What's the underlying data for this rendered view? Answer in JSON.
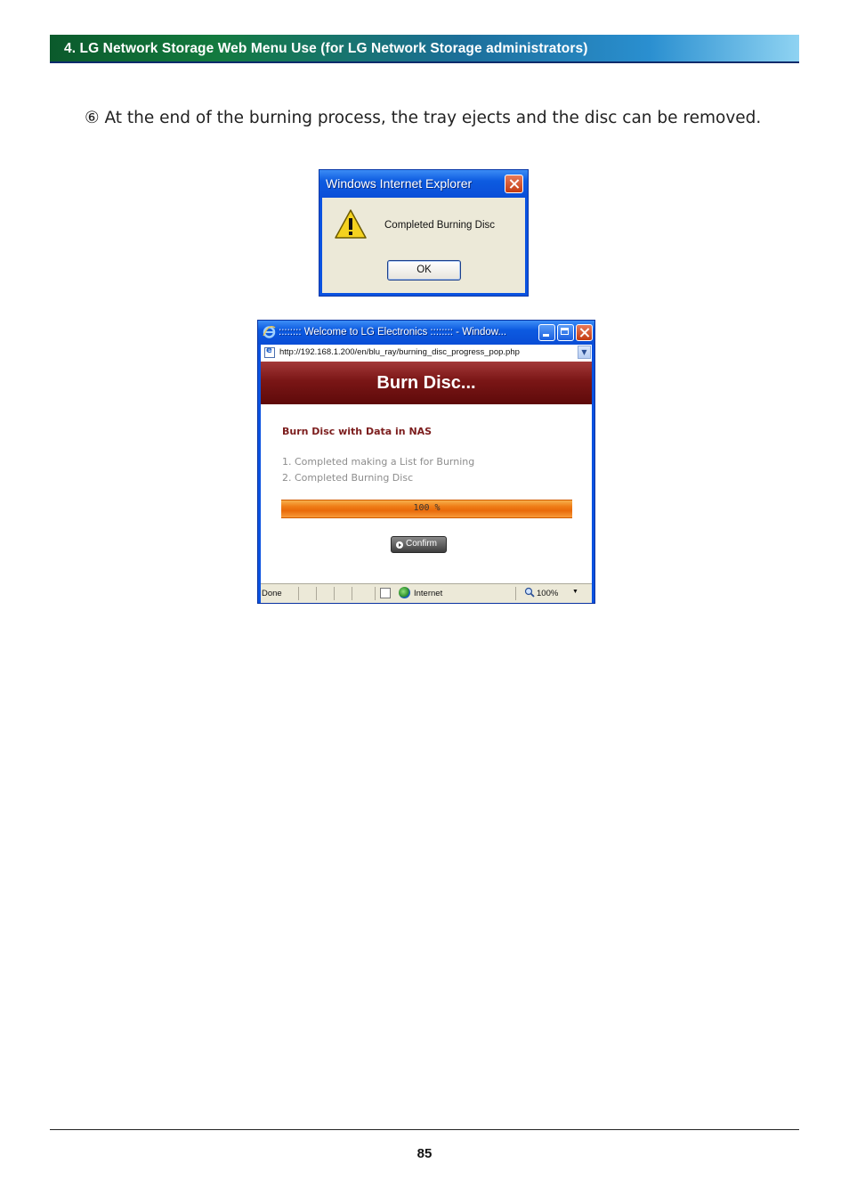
{
  "header": {
    "title": "4. LG Network Storage Web Menu Use (for LG Network Storage administrators)"
  },
  "step": {
    "text": "⑥ At the end of the burning process, the tray ejects and the disc can be removed."
  },
  "alert_dialog": {
    "title": "Windows Internet Explorer",
    "message": "Completed Burning Disc",
    "ok_label": "OK"
  },
  "popup": {
    "title": ":::::::: Welcome to LG Electronics :::::::: - Window...",
    "url": "http://192.168.1.200/en/blu_ray/burning_disc_progress_pop.php",
    "banner": "Burn Disc...",
    "subheading": "Burn Disc with Data in NAS",
    "steps": [
      "1. Completed making a List for Burning",
      "2. Completed Burning Disc"
    ],
    "progress_text": "100 %",
    "progress_fraction": 1.0,
    "confirm_label": "Confirm",
    "status_left": "Done",
    "status_zone": "Internet",
    "status_zoom": "100%"
  },
  "footer": {
    "page_number": "85"
  },
  "colors": {
    "banner": "#7a1616",
    "progress": "#ef7d17",
    "subheading": "#7c1d1d",
    "title_bar": "#0a52e0"
  },
  "icons": [
    "warning-icon",
    "close-icon",
    "ie-icon",
    "minimize-icon",
    "maximize-icon",
    "page-icon",
    "globe-icon",
    "zoom-icon"
  ]
}
